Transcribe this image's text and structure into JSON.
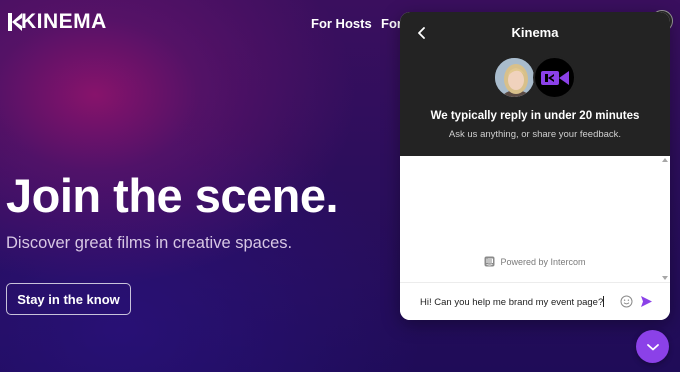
{
  "site": {
    "brand": "KINEMA",
    "nav": [
      "For Hosts",
      "For F"
    ],
    "hero": {
      "title": "Join the scene.",
      "subtitle": "Discover great films in creative spaces.",
      "cta_label": "Stay in the know"
    }
  },
  "messenger": {
    "title": "Kinema",
    "reply_time": "We typically reply in under 20 minutes",
    "prompt": "Ask us anything, or share your feedback.",
    "powered_by": "Powered by Intercom",
    "input_value": "Hi! Can you help me brand my event page?",
    "icons": {
      "back": "chevron-left-icon",
      "brand_avatar": "video-camera-icon",
      "emoji": "smile-icon",
      "send": "send-icon",
      "launcher": "chevron-down-icon"
    }
  },
  "colors": {
    "accent": "#8b41e8",
    "header_dark": "#232323",
    "hero_bg": "#2b0e5c"
  }
}
